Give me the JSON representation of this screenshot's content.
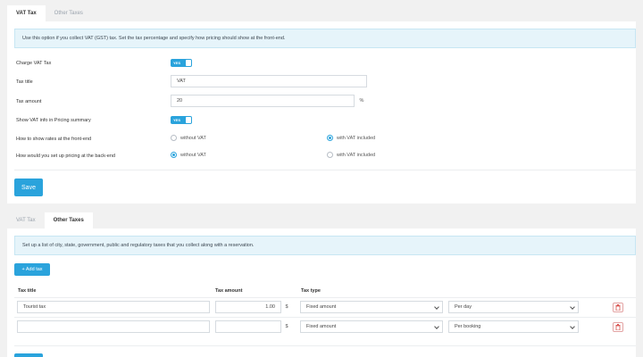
{
  "vat_section": {
    "tabs": [
      "VAT Tax",
      "Other Taxes"
    ],
    "info": "Use this option if you collect VAT (GST) tax. Set the tax percentage and specify how pricing should show at the front-end.",
    "charge_vat": {
      "label": "Charge VAT Tax",
      "toggle": "YES"
    },
    "tax_title": {
      "label": "Tax title",
      "value": "VAT"
    },
    "tax_amount": {
      "label": "Tax amount",
      "value": "20",
      "suffix": "%"
    },
    "show_vat_info": {
      "label": "Show VAT info in Pricing summary",
      "toggle": "YES"
    },
    "front_end": {
      "label": "How to show rates at the front-end",
      "option_1": "without VAT",
      "option_2": "with VAT included",
      "selected": "with VAT included"
    },
    "back_end": {
      "label": "How would you set up pricing at the back-end",
      "option_1": "without VAT",
      "option_2": "with VAT included",
      "selected": "without VAT"
    },
    "save_label": "Save"
  },
  "other_section": {
    "tabs": [
      "VAT Tax",
      "Other Taxes"
    ],
    "info": "Set up a list of city, state, government, public and regulatory taxes that you collect along with a reservation.",
    "add_label": "+ Add tax",
    "columns": [
      "Tax title",
      "Tax amount",
      "Tax type"
    ],
    "rows": [
      {
        "title": "Tourist tax",
        "title_placeholder": "",
        "amount": "1.00",
        "suffix": "$",
        "type": "Fixed amount",
        "period": "Per day"
      },
      {
        "title": "",
        "title_placeholder": "",
        "amount": "",
        "suffix": "$",
        "type": "Fixed amount",
        "period": "Per booking"
      }
    ]
  },
  "colors": {
    "accent": "#2aa3dc",
    "info_bg": "#e6f4fa",
    "danger": "#d9534f"
  }
}
